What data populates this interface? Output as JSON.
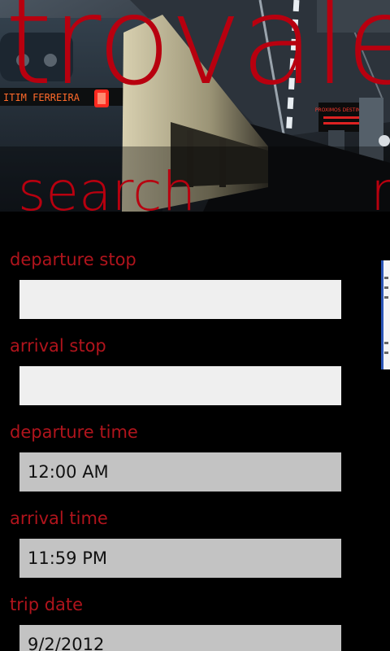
{
  "app": {
    "title": "trovale"
  },
  "pivot": {
    "items": [
      {
        "label": "search"
      },
      {
        "label": "r"
      }
    ]
  },
  "form": {
    "fields": [
      {
        "label": "departure stop",
        "value": "",
        "placeholder": ""
      },
      {
        "label": "arrival stop",
        "value": "",
        "placeholder": ""
      },
      {
        "label": "departure time",
        "value": "12:00 AM"
      },
      {
        "label": "arrival time",
        "value": "11:59 PM"
      },
      {
        "label": "trip date",
        "value": "9/2/2012"
      }
    ]
  },
  "background": {
    "train_sign_text": "ITIM FERREIRA",
    "station_sign_text": "PROXIMOS DESTINOS"
  },
  "colors": {
    "accent": "#b8000f",
    "background": "#000000",
    "input_empty": "#efefef",
    "input_filled": "#c3c3c3"
  }
}
